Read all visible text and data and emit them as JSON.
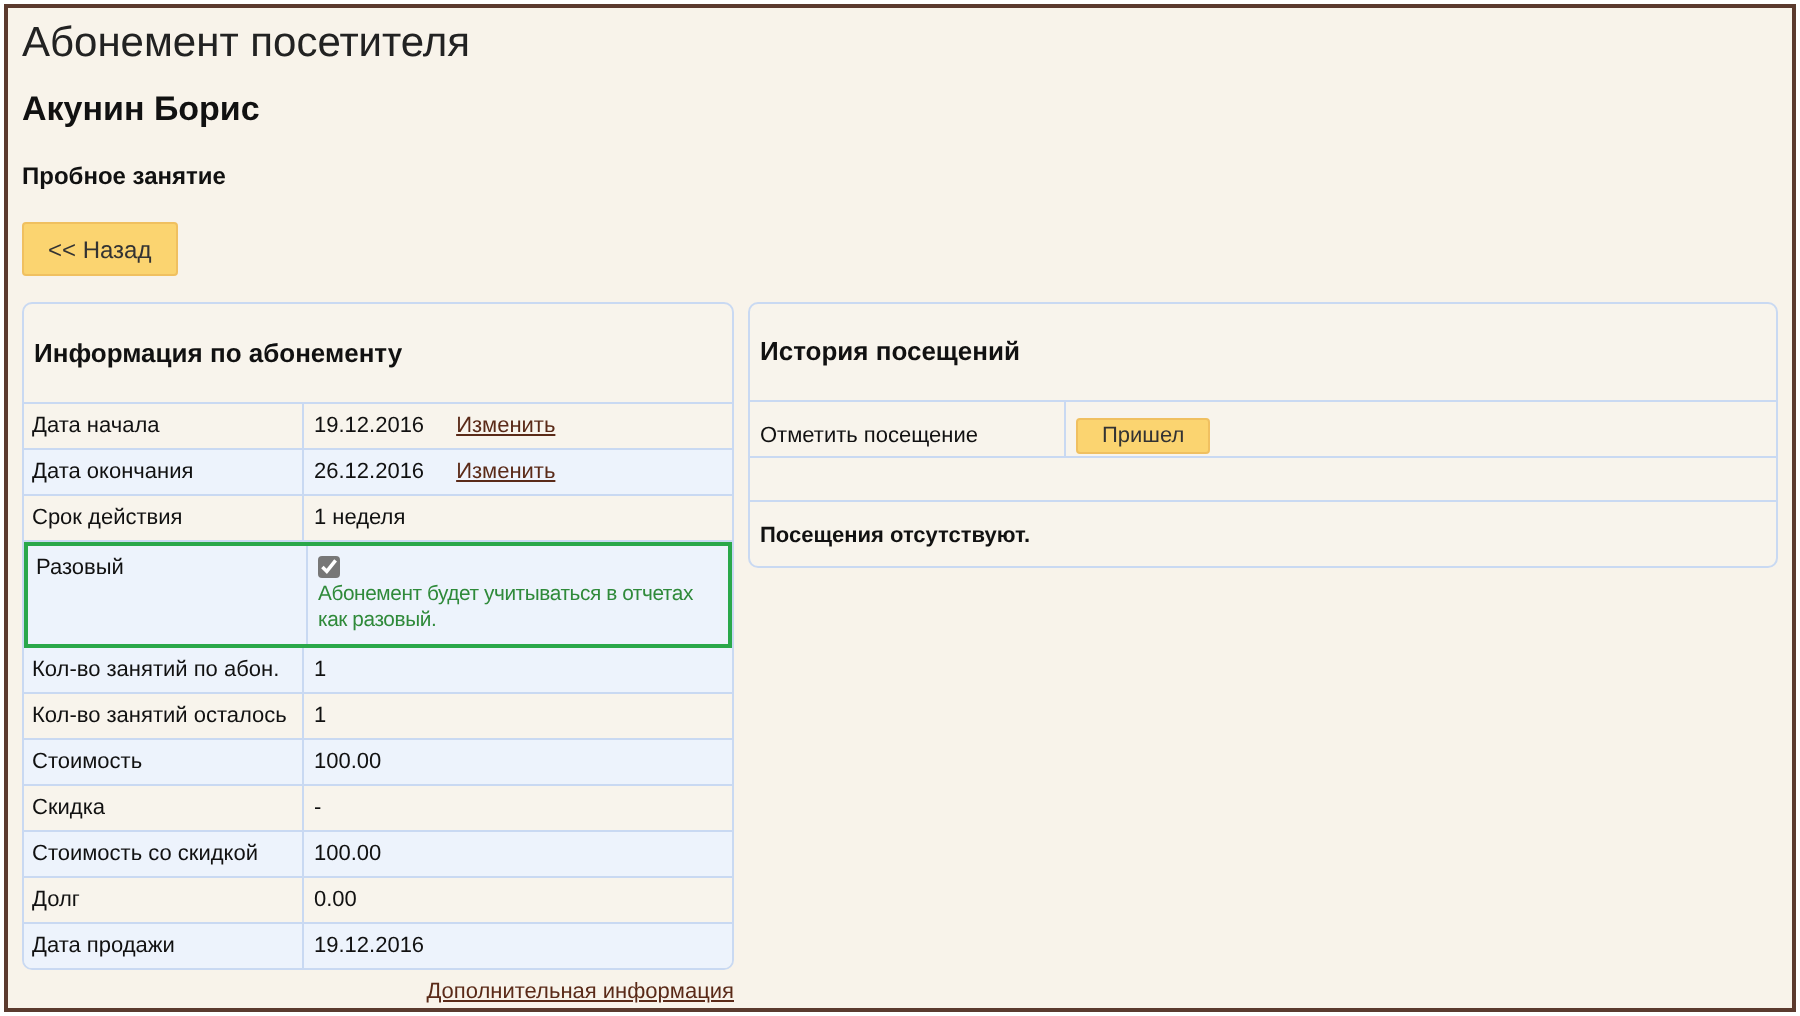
{
  "page_title": "Абонемент посетителя",
  "visitor_name": "Акунин Борис",
  "subscription_type": "Пробное занятие",
  "back_button": "<< Назад",
  "info_panel": {
    "title": "Информация по абонементу",
    "rows": [
      {
        "kind": "text",
        "label": "Дата начала",
        "value": "19.12.2016",
        "link": "Изменить",
        "shaded": false
      },
      {
        "kind": "text",
        "label": "Дата окончания",
        "value": "26.12.2016",
        "link": "Изменить",
        "shaded": true
      },
      {
        "kind": "text",
        "label": "Срок действия",
        "value": "1 неделя",
        "shaded": false
      },
      {
        "kind": "checkbox",
        "label": "Разовый",
        "checked": true,
        "note": "Абонемент будет учитываться в отчетах как разовый.",
        "highlighted": true,
        "shaded": true
      },
      {
        "kind": "text",
        "label": "Кол-во занятий по абон.",
        "value": "1",
        "shaded": true
      },
      {
        "kind": "text",
        "label": "Кол-во занятий осталось",
        "value": "1",
        "shaded": false
      },
      {
        "kind": "text",
        "label": "Стоимость",
        "value": "100.00",
        "shaded": true
      },
      {
        "kind": "text",
        "label": "Скидка",
        "value": "-",
        "shaded": false
      },
      {
        "kind": "text",
        "label": "Стоимость со скидкой",
        "value": "100.00",
        "shaded": true
      },
      {
        "kind": "text",
        "label": "Долг",
        "value": "0.00",
        "shaded": false
      },
      {
        "kind": "text",
        "label": "Дата продажи",
        "value": "19.12.2016",
        "shaded": true
      }
    ],
    "more_link": "Дополнительная информация"
  },
  "history_panel": {
    "title": "История посещений",
    "mark_label": "Отметить посещение",
    "mark_button": "Пришел",
    "empty_message": "Посещения отсутствуют."
  }
}
